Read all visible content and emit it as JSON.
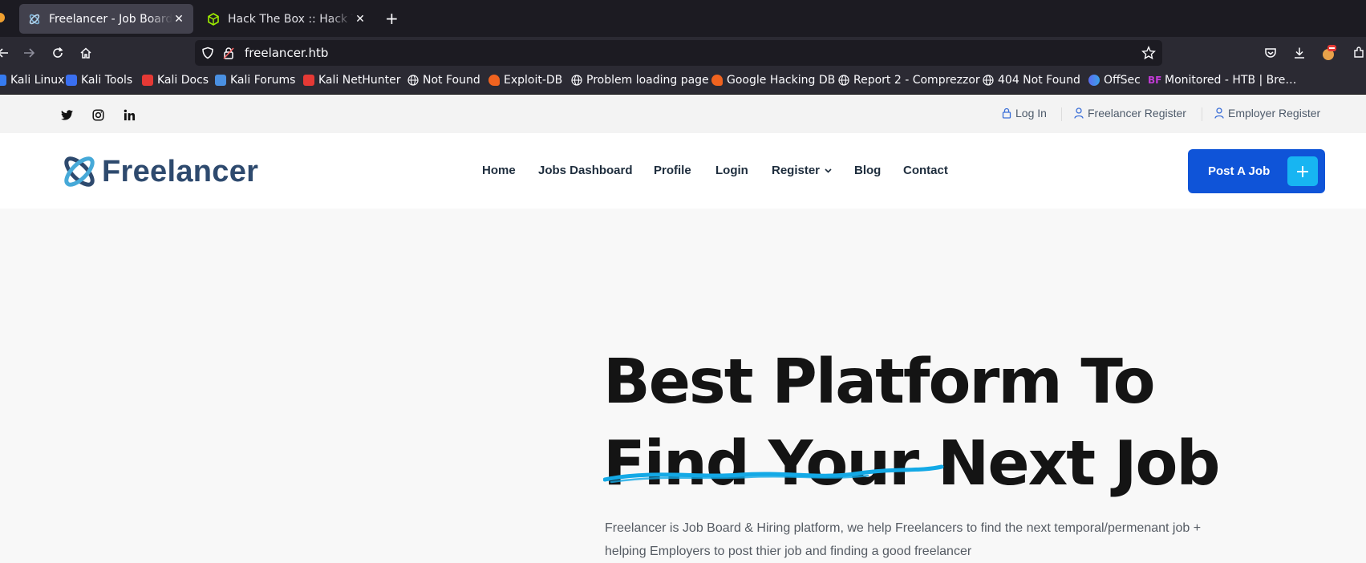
{
  "browser": {
    "tabs": [
      {
        "title": "Freelancer - Job Board & Hiring platform",
        "active": true
      },
      {
        "title": "Hack The Box :: Hack The Box",
        "active": false
      }
    ],
    "new_tab_glyph": "+",
    "close_glyph": "✕",
    "url": "freelancer.htb",
    "bookmarks": [
      {
        "label": "Kali Linux",
        "icon": "kali-icon",
        "color": "#367bf0"
      },
      {
        "label": "Kali Tools",
        "icon": "kali-tools-icon",
        "color": "#e0e0ff"
      },
      {
        "label": "Kali Docs",
        "icon": "kali-docs-icon",
        "color": "#e53935"
      },
      {
        "label": "Kali Forums",
        "icon": "kali-forums-icon",
        "color": "#4a90e2"
      },
      {
        "label": "Kali NetHunter",
        "icon": "nethunter-icon",
        "color": "#e53935"
      },
      {
        "label": "Not Found",
        "icon": "globe-icon",
        "color": ""
      },
      {
        "label": "Exploit-DB",
        "icon": "exploitdb-icon",
        "color": "#f0631f"
      },
      {
        "label": "Problem loading page",
        "icon": "globe-icon",
        "color": ""
      },
      {
        "label": "Google Hacking DB",
        "icon": "ghdb-icon",
        "color": "#f0631f"
      },
      {
        "label": "Report 2 - Comprezzor",
        "icon": "globe-icon",
        "color": ""
      },
      {
        "label": "404 Not Found",
        "icon": "globe-icon",
        "color": ""
      },
      {
        "label": "OffSec",
        "icon": "offsec-icon",
        "color": "#5b6cf0"
      },
      {
        "label": "Monitored - HTB | Bre…",
        "icon": "bf-icon",
        "color": "#c23bd6"
      }
    ]
  },
  "topbar": {
    "login": "Log In",
    "freelancer_register": "Freelancer Register",
    "employer_register": "Employer Register"
  },
  "header": {
    "logo_text": "Freelancer",
    "menu": [
      "Home",
      "Jobs Dashboard",
      "Profile",
      "Login",
      "Register",
      "Blog",
      "Contact"
    ],
    "post_job": "Post A Job",
    "post_job_icon": "+"
  },
  "hero": {
    "line1": "Best Platform To",
    "line2": "Find Your Next Job",
    "description": "Freelancer is Job Board & Hiring platform, we help Freelancers to find the next temporal/permenant job + helping Employers to post thier job and finding a good freelancer"
  },
  "colors": {
    "brand_blue": "#0f54d8",
    "accent_cyan": "#17b5f2",
    "logo_text": "#2e4a6e",
    "chrome_bg": "#1c1b22",
    "toolbar_bg": "#2b2a33"
  }
}
